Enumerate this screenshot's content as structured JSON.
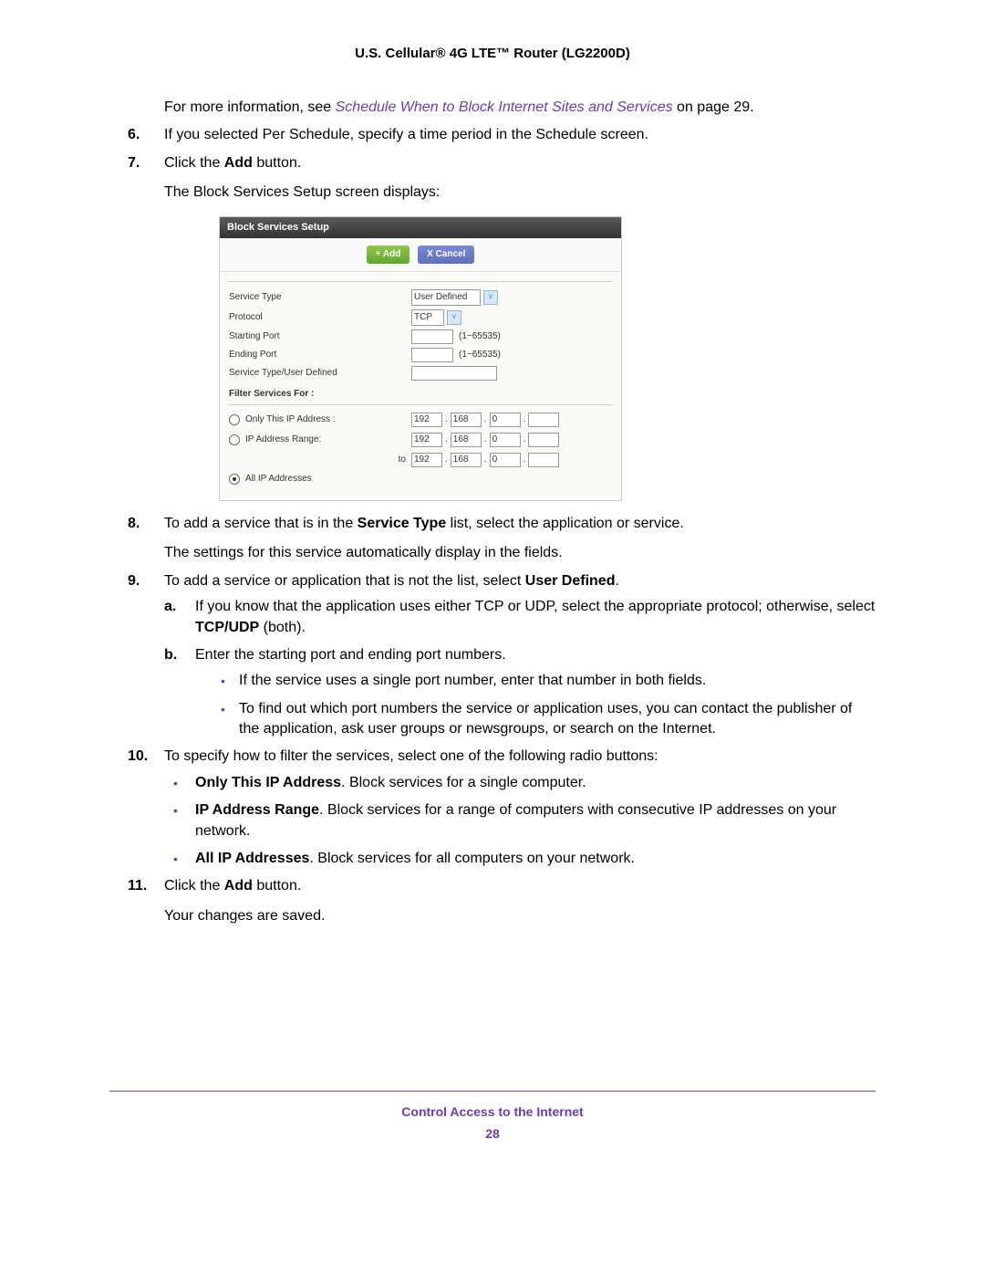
{
  "header": "U.S. Cellular® 4G LTE™ Router (LG2200D)",
  "intro": {
    "prefix": "For more information, see ",
    "link": "Schedule When to Block Internet Sites and Services",
    "suffix_on": " on page 29."
  },
  "steps": {
    "s6": {
      "num": "6.",
      "text": "If you selected Per Schedule, specify a time period in the Schedule screen."
    },
    "s7": {
      "num": "7.",
      "pre": "Click the ",
      "bold": "Add",
      "post": " button.",
      "after": "The Block Services Setup screen displays:"
    },
    "s8": {
      "num": "8.",
      "pre": "To add a service that is in the ",
      "bold": "Service Type",
      "post": " list, select the application or service.",
      "after": "The settings for this service automatically display in the fields."
    },
    "s9": {
      "num": "9.",
      "pre": "To add a service or application that is not the list, select ",
      "bold": "User Defined",
      "post": ".",
      "a": {
        "label": "a.",
        "pre": "If you know that the application uses either TCP or UDP, select the appropriate protocol; otherwise, select ",
        "bold": "TCP/UDP",
        "post": " (both)."
      },
      "b": {
        "label": "b.",
        "text": "Enter the starting port and ending port numbers.",
        "bullets": [
          "If the service uses a single port number, enter that number in both fields.",
          "To find out which port numbers the service or application uses, you can contact the publisher of the application, ask user groups or newsgroups, or search on the Internet."
        ]
      }
    },
    "s10": {
      "num": "10.",
      "text": "To specify how to filter the services, select one of the following radio buttons:",
      "bullets": [
        {
          "bold": "Only This IP Address",
          "rest": ". Block services for a single computer."
        },
        {
          "bold": "IP Address Range",
          "rest": ". Block services for a range of computers with consecutive IP addresses on your network."
        },
        {
          "bold": "All IP Addresses",
          "rest": ". Block services for all computers on your network."
        }
      ]
    },
    "s11": {
      "num": "11.",
      "pre": "Click the ",
      "bold": "Add",
      "post": " button.",
      "after": "Your changes are saved."
    }
  },
  "figure": {
    "title": "Block Services Setup",
    "add_btn": "+ Add",
    "cancel_btn": "X Cancel",
    "labels": {
      "service_type": "Service Type",
      "protocol": "Protocol",
      "starting_port": "Starting Port",
      "ending_port": "Ending Port",
      "user_defined": "Service Type/User Defined",
      "filter_for": "Filter Services For :",
      "only_this": "Only This IP Address :",
      "ip_range": "IP Address Range:",
      "all_ip": "All IP Addresses",
      "to": "to"
    },
    "values": {
      "service_type_sel": "User Defined",
      "protocol_sel": "TCP",
      "port_hint": "(1~65535)",
      "ip1": "192",
      "ip2": "168",
      "ip3": "0",
      "ip4": ""
    }
  },
  "footer": {
    "title": "Control Access to the Internet",
    "page": "28"
  }
}
